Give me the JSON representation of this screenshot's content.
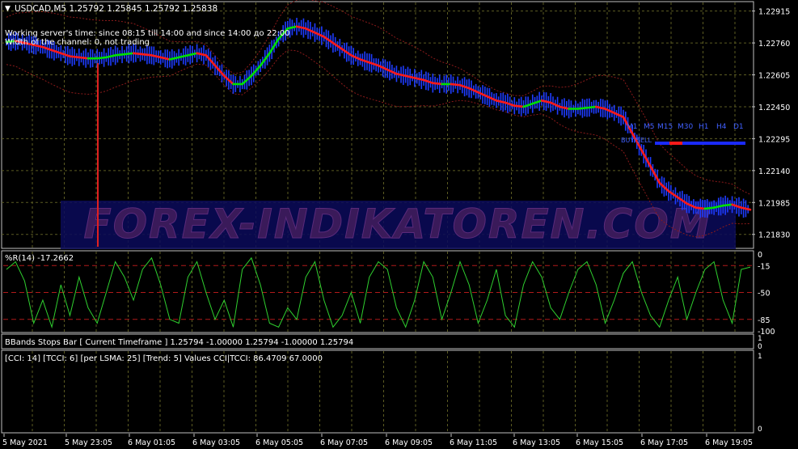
{
  "main": {
    "symbol_header": "USDCAD,M5  1.25792 1.25845 1.25792 1.25838",
    "info_line1": "Working server's time: since 08:15 till 14:00 and since 14:00 до 22:00",
    "info_line2": "Width of the channel: 0, not trading",
    "price_ticks": [
      "1.22915",
      "1.22760",
      "1.22605",
      "1.22450",
      "1.22295",
      "1.22140",
      "1.21985",
      "1.21830"
    ],
    "tf_labels": [
      "M1",
      "M5",
      "M15",
      "M30",
      "H1",
      "H4",
      "D1"
    ],
    "buysell_label": "BUY/SELL",
    "watermark": "FOREX-INDIKATOREN.COM",
    "price_range": [
      1.2177,
      1.22945
    ],
    "price_series": [
      1.22765,
      1.2277,
      1.2276,
      1.2275,
      1.2274,
      1.22725,
      1.2271,
      1.22695,
      1.2269,
      1.22685,
      1.22685,
      1.2269,
      1.227,
      1.22705,
      1.2271,
      1.22705,
      1.227,
      1.2269,
      1.2268,
      1.2269,
      1.227,
      1.2271,
      1.227,
      1.2265,
      1.226,
      1.2256,
      1.2256,
      1.226,
      1.2265,
      1.2271,
      1.2278,
      1.2283,
      1.2284,
      1.2283,
      1.2281,
      1.2279,
      1.2276,
      1.2273,
      1.227,
      1.2268,
      1.22665,
      1.2265,
      1.2263,
      1.2261,
      1.226,
      1.2259,
      1.2258,
      1.22565,
      1.2256,
      1.2256,
      1.22555,
      1.2254,
      1.2252,
      1.225,
      1.2248,
      1.2247,
      1.22455,
      1.2245,
      1.22465,
      1.2248,
      1.2247,
      1.2245,
      1.2244,
      1.2244,
      1.22445,
      1.2245,
      1.2244,
      1.2242,
      1.224,
      1.2232,
      1.2224,
      1.2216,
      1.2208,
      1.2204,
      1.2201,
      1.2198,
      1.2196,
      1.21955,
      1.2196,
      1.2197,
      1.21975,
      1.2196,
      1.2195
    ]
  },
  "wpr": {
    "label": "%R(14) -17.2662",
    "ticks": [
      "0",
      "-15",
      "-50",
      "-85",
      "-100"
    ],
    "values": [
      -20,
      -10,
      -35,
      -90,
      -60,
      -95,
      -40,
      -80,
      -30,
      -70,
      -90,
      -50,
      -10,
      -30,
      -60,
      -20,
      -5,
      -40,
      -85,
      -90,
      -30,
      -10,
      -50,
      -85,
      -60,
      -95,
      -20,
      -5,
      -40,
      -90,
      -95,
      -70,
      -85,
      -30,
      -10,
      -60,
      -95,
      -80,
      -50,
      -90,
      -30,
      -10,
      -20,
      -70,
      -95,
      -60,
      -10,
      -30,
      -85,
      -50,
      -10,
      -40,
      -90,
      -60,
      -20,
      -80,
      -95,
      -40,
      -10,
      -30,
      -70,
      -85,
      -50,
      -20,
      -10,
      -40,
      -90,
      -60,
      -25,
      -10,
      -50,
      -80,
      -95,
      -60,
      -30,
      -85,
      -50,
      -20,
      -10,
      -60,
      -90,
      -20,
      -17
    ]
  },
  "bbands": {
    "label": "BBands Stops Bar  [ Current Timeframe   ] 1.25794 -1.00000 1.25794 -1.00000 1.25794",
    "ticks": [
      "1",
      "0"
    ]
  },
  "cci": {
    "label": "[CCI: 14] [TCCI: 6] [per LSMA: 25] [Trend: 5] Values CCI|TCCI: 86.4709 67.0000",
    "ticks": [
      "1",
      "0"
    ]
  },
  "time_axis": [
    "5 May 2021",
    "5 May 23:05",
    "6 May 01:05",
    "6 May 03:05",
    "6 May 05:05",
    "6 May 07:05",
    "6 May 09:05",
    "6 May 11:05",
    "6 May 13:05",
    "6 May 15:05",
    "6 May 17:05",
    "6 May 19:05"
  ],
  "colors": {
    "background": "#000000",
    "grid": "#5b5b22",
    "frame": "#c0c0c0",
    "candle_body": "#1e3cff",
    "ma_up": "#00e000",
    "ma_down": "#ff1a1a",
    "band": "#8b1a1a",
    "wpr_line": "#2fd02f",
    "level": "#b01a1a",
    "text": "#ffffff",
    "tf_text": "#4060ff",
    "vline": "#e02020"
  }
}
